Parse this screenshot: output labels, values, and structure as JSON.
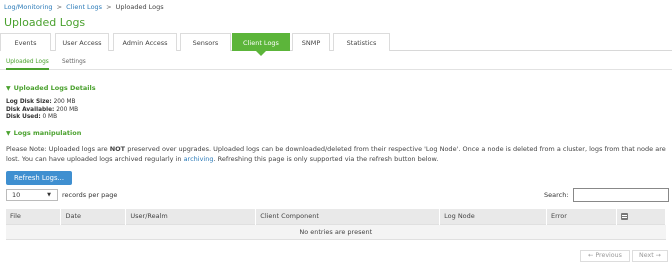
{
  "breadcrumb": {
    "items": [
      "Log/Monitoring",
      "Client Logs",
      "Uploaded Logs"
    ],
    "separator": ">"
  },
  "page_title": "Uploaded Logs",
  "tabs": [
    {
      "label": "Events",
      "active": false
    },
    {
      "label": "User Access",
      "active": false
    },
    {
      "label": "Admin Access",
      "active": false
    },
    {
      "label": "Sensors",
      "active": false
    },
    {
      "label": "Client Logs",
      "active": true
    },
    {
      "label": "SNMP",
      "active": false
    },
    {
      "label": "Statistics",
      "active": false
    }
  ],
  "subtabs": [
    {
      "label": "Uploaded Logs",
      "active": true
    },
    {
      "label": "Settings",
      "active": false
    }
  ],
  "details_section": {
    "title": "Uploaded Logs Details",
    "stats": [
      {
        "label": "Log Disk Size:",
        "value": "200 MB"
      },
      {
        "label": "Disk Available:",
        "value": "200 MB"
      },
      {
        "label": "Disk Used:",
        "value": "0 MB"
      }
    ]
  },
  "manipulation_section": {
    "title": "Logs manipulation",
    "note_1": "Please Note: Uploaded logs are ",
    "note_bold": "NOT",
    "note_2": " preserved over upgrades. Uploaded logs can be downloaded/deleted from their respective 'Log Node'. Once a node is deleted from a cluster, logs from that node are lost. You can have uploaded logs archived regularly in ",
    "note_link": "archiving",
    "note_3": ". Refreshing this page is only supported via the refresh button below."
  },
  "refresh_button": "Refresh Logs...",
  "records": {
    "selected": "10",
    "label": "records per page"
  },
  "search": {
    "label": "Search:",
    "value": "",
    "placeholder": ""
  },
  "table": {
    "columns": [
      "File",
      "Date",
      "User/Realm",
      "Client Component",
      "Log Node",
      "Error"
    ],
    "empty_message": "No entries are present"
  },
  "pagination": {
    "previous": "← Previous",
    "next": "Next →"
  },
  "colors": {
    "accent_green": "#5cb53a",
    "title_green": "#4aa12e",
    "button_blue": "#3f8fd0",
    "link_blue": "#2a7ab8"
  },
  "icons": {
    "section_toggle": "chevron-down-icon",
    "column_chooser": "columns-icon",
    "select_arrow": "caret-down-icon"
  }
}
